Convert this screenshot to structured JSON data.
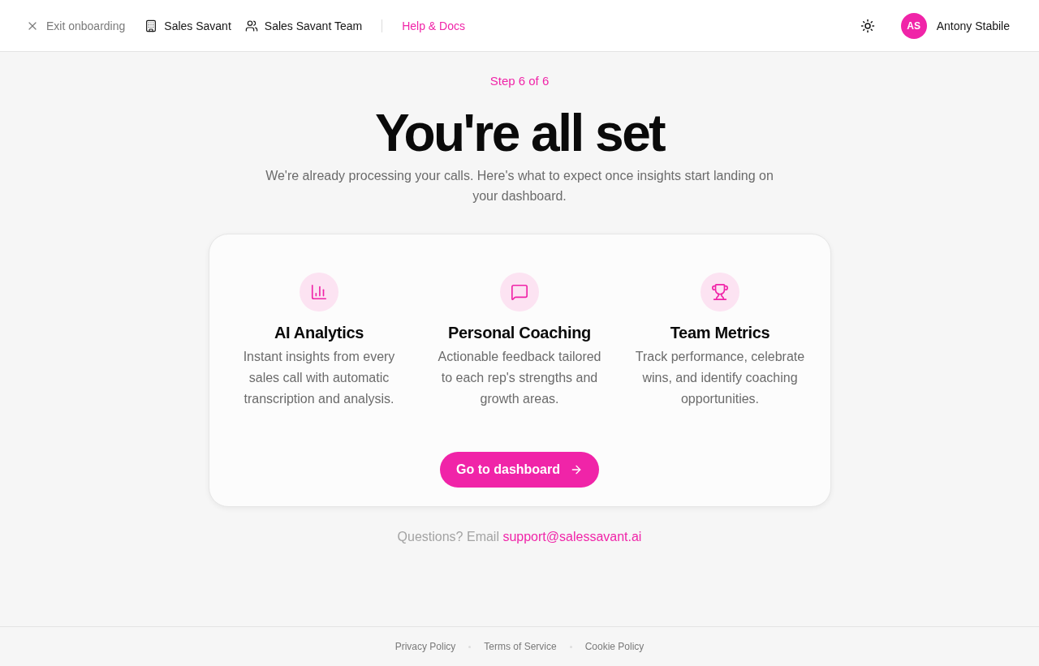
{
  "header": {
    "exit": {
      "label": "Exit onboarding"
    },
    "breadcrumbs": [
      {
        "kind": "organization",
        "label": "Sales Savant"
      },
      {
        "kind": "team",
        "label": "Sales Savant Team"
      }
    ],
    "help_link": {
      "label": "Help & Docs"
    },
    "user": {
      "initials": "AS",
      "name": "Antony Stabile"
    }
  },
  "onboarding": {
    "step": "Step 6 of 6",
    "title": "You're all set",
    "subtitle": "We're already processing your calls. Here's what to expect once insights start landing on your dashboard."
  },
  "features": [
    {
      "kind": "analytics",
      "title": "AI Analytics",
      "description": "Instant insights from every sales call with automatic transcription and analysis."
    },
    {
      "kind": "coaching",
      "title": "Personal Coaching",
      "description": "Actionable feedback tailored to each rep's strengths and growth areas."
    },
    {
      "kind": "metrics",
      "title": "Team Metrics",
      "description": "Track performance, celebrate wins, and identify coaching opportunities."
    }
  ],
  "cta": {
    "label": "Go to dashboard"
  },
  "contact": {
    "text": "Questions? Email",
    "email": "support@salessavant.ai"
  },
  "footer_links": [
    "Privacy Policy",
    "Terms of Service",
    "Cookie Policy"
  ]
}
